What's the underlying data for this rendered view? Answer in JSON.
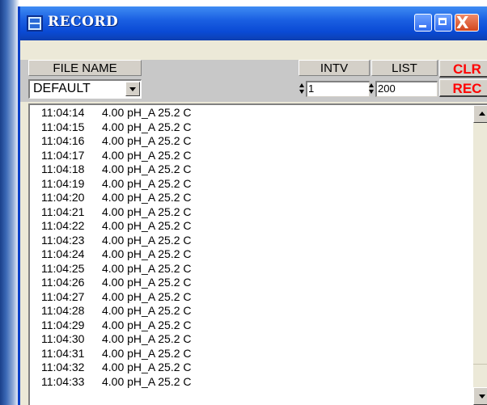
{
  "window": {
    "title": "RECORD",
    "icon": "app-icon"
  },
  "titlebar_buttons": {
    "minimize_icon": "minimize-icon",
    "maximize_icon": "maximize-icon",
    "close_icon": "close-icon",
    "close_glyph": "X"
  },
  "controls": {
    "file_name_label": "FILE NAME",
    "file_name_value": "DEFAULT",
    "intv_label": "INTV",
    "intv_value": "1",
    "list_label": "LIST",
    "list_value": "200",
    "clr_button": "CLR",
    "rec_button": "REC",
    "accent_color": "#ff0000"
  },
  "records": [
    {
      "time": "11:04:14",
      "reading": "4.00 pH_A 25.2 C"
    },
    {
      "time": "11:04:15",
      "reading": "4.00 pH_A 25.2 C"
    },
    {
      "time": "11:04:16",
      "reading": "4.00 pH_A 25.2 C"
    },
    {
      "time": "11:04:17",
      "reading": "4.00 pH_A 25.2 C"
    },
    {
      "time": "11:04:18",
      "reading": "4.00 pH_A 25.2 C"
    },
    {
      "time": "11:04:19",
      "reading": "4.00 pH_A 25.2 C"
    },
    {
      "time": "11:04:20",
      "reading": "4.00 pH_A 25.2 C"
    },
    {
      "time": "11:04:21",
      "reading": "4.00 pH_A 25.2 C"
    },
    {
      "time": "11:04:22",
      "reading": "4.00 pH_A 25.2 C"
    },
    {
      "time": "11:04:23",
      "reading": "4.00 pH_A 25.2 C"
    },
    {
      "time": "11:04:24",
      "reading": "4.00 pH_A 25.2 C"
    },
    {
      "time": "11:04:25",
      "reading": "4.00 pH_A 25.2 C"
    },
    {
      "time": "11:04:26",
      "reading": "4.00 pH_A 25.2 C"
    },
    {
      "time": "11:04:27",
      "reading": "4.00 pH_A 25.2 C"
    },
    {
      "time": "11:04:28",
      "reading": "4.00 pH_A 25.2 C"
    },
    {
      "time": "11:04:29",
      "reading": "4.00 pH_A 25.2 C"
    },
    {
      "time": "11:04:30",
      "reading": "4.00 pH_A 25.2 C"
    },
    {
      "time": "11:04:31",
      "reading": "4.00 pH_A 25.2 C"
    },
    {
      "time": "11:04:32",
      "reading": "4.00 pH_A 25.2 C"
    },
    {
      "time": "11:04:33",
      "reading": "4.00 pH_A 25.2 C"
    }
  ],
  "scrollbar": {
    "up_icon": "scroll-up-arrow-icon",
    "down_icon": "scroll-down-arrow-icon"
  }
}
